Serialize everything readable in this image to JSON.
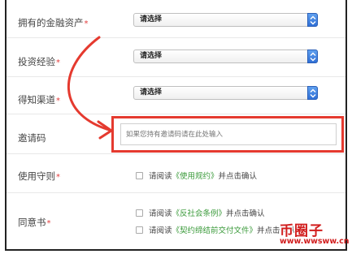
{
  "form": {
    "financial_assets": {
      "label": "拥有的金融资产",
      "required": "*",
      "select_value": "请选择"
    },
    "investment_experience": {
      "label": "投资经验",
      "required": "*",
      "select_value": "请选择"
    },
    "referral_channel": {
      "label": "得知渠道",
      "required": "*",
      "select_value": "请选择"
    },
    "invite_code": {
      "label": "邀请码",
      "placeholder": "如果您持有邀请码请在此处输入"
    },
    "terms_of_use": {
      "label": "使用守则",
      "required": "*",
      "check_prefix": "请阅读",
      "check_link": "《使用规约》",
      "check_suffix": "并点击确认"
    },
    "consent": {
      "label": "同意书",
      "required": "*",
      "items": [
        {
          "prefix": "请阅读",
          "link": "《反社会条例》",
          "suffix": "并点击确认"
        },
        {
          "prefix": "请阅读",
          "link": "《契约缔结前交付文件》",
          "suffix": "并点击确认"
        }
      ]
    }
  },
  "watermark": {
    "title": "币圈子",
    "url": "www.wwsww.cn"
  },
  "colors": {
    "highlight": "#e53a2f",
    "arrow": "#e53a2f",
    "link": "#3a9a3a",
    "required": "#e23b3b"
  }
}
